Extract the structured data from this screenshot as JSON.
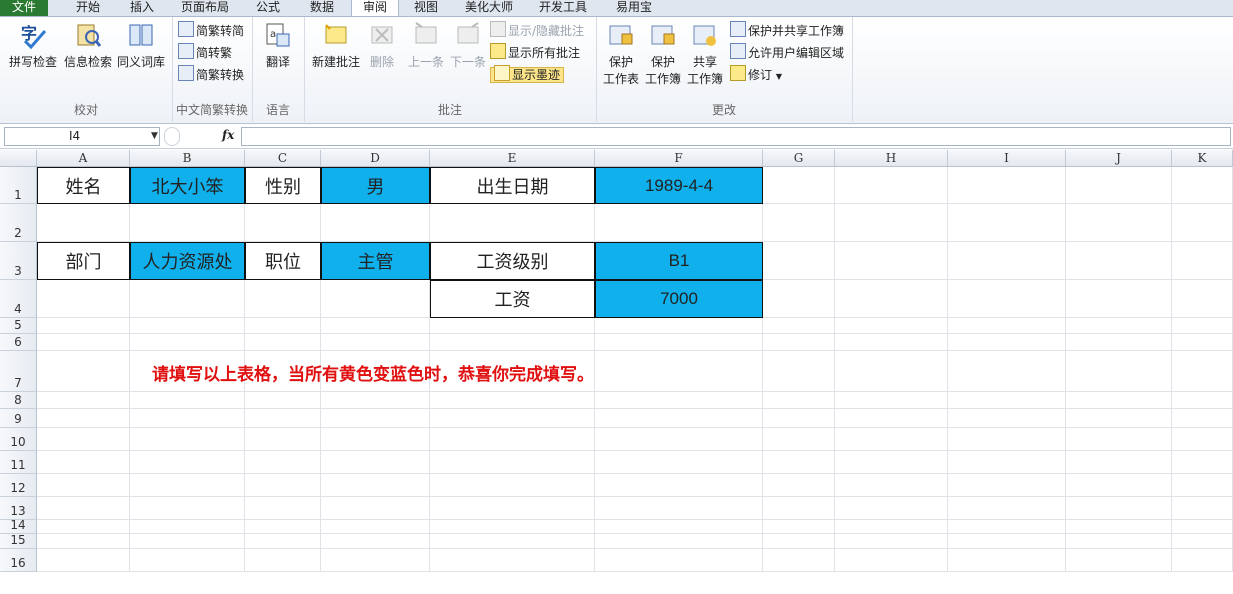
{
  "tabs": [
    "文件",
    "开始",
    "插入",
    "页面布局",
    "公式",
    "数据",
    "审阅",
    "视图",
    "美化大师",
    "开发工具",
    "易用宝"
  ],
  "ribbon": {
    "proofing": {
      "label": "校对",
      "items": [
        "拼写检查",
        "信息检索",
        "同义词库"
      ]
    },
    "chinese": {
      "label": "中文简繁转换",
      "items": [
        "简繁转简",
        "简转繁",
        "简繁转换"
      ]
    },
    "language": {
      "label": "语言",
      "items": [
        "翻译"
      ]
    },
    "comments": {
      "label": "批注",
      "items": [
        "新建批注",
        "删除",
        "上一条",
        "下一条"
      ],
      "small": [
        "显示/隐藏批注",
        "显示所有批注",
        "显示墨迹"
      ]
    },
    "changes": {
      "label": "更改",
      "items": [
        [
          "保护",
          "工作表"
        ],
        [
          "保护",
          "工作簿"
        ],
        [
          "共享",
          "工作簿"
        ]
      ],
      "small": [
        "保护并共享工作簿",
        "允许用户编辑区域",
        "修订"
      ]
    }
  },
  "formula_bar": {
    "name_box": "I4",
    "fx": "fx",
    "value": ""
  },
  "columns": [
    "A",
    "B",
    "C",
    "D",
    "E",
    "F",
    "G",
    "H",
    "I",
    "J",
    "K"
  ],
  "rows": [
    "1",
    "2",
    "3",
    "4",
    "5",
    "6",
    "7",
    "8",
    "9",
    "10",
    "11",
    "12",
    "13",
    "14",
    "15",
    "16"
  ],
  "cells": {
    "A1": "姓名",
    "B1": "北大小笨",
    "C1": "性别",
    "D1": "男",
    "E1": "出生日期",
    "F1": "1989-4-4",
    "A3": "部门",
    "B3": "人力资源处",
    "C3": "职位",
    "D3": "主管",
    "E3": "工资级别",
    "F3": "B1",
    "E4": "工资",
    "F4": "7000"
  },
  "note": "请填写以上表格，当所有黄色变蓝色时，恭喜你完成填写。",
  "colors": {
    "filled": "#0fb0ec",
    "note": "#e01010",
    "file_tab": "#2a7a32"
  }
}
